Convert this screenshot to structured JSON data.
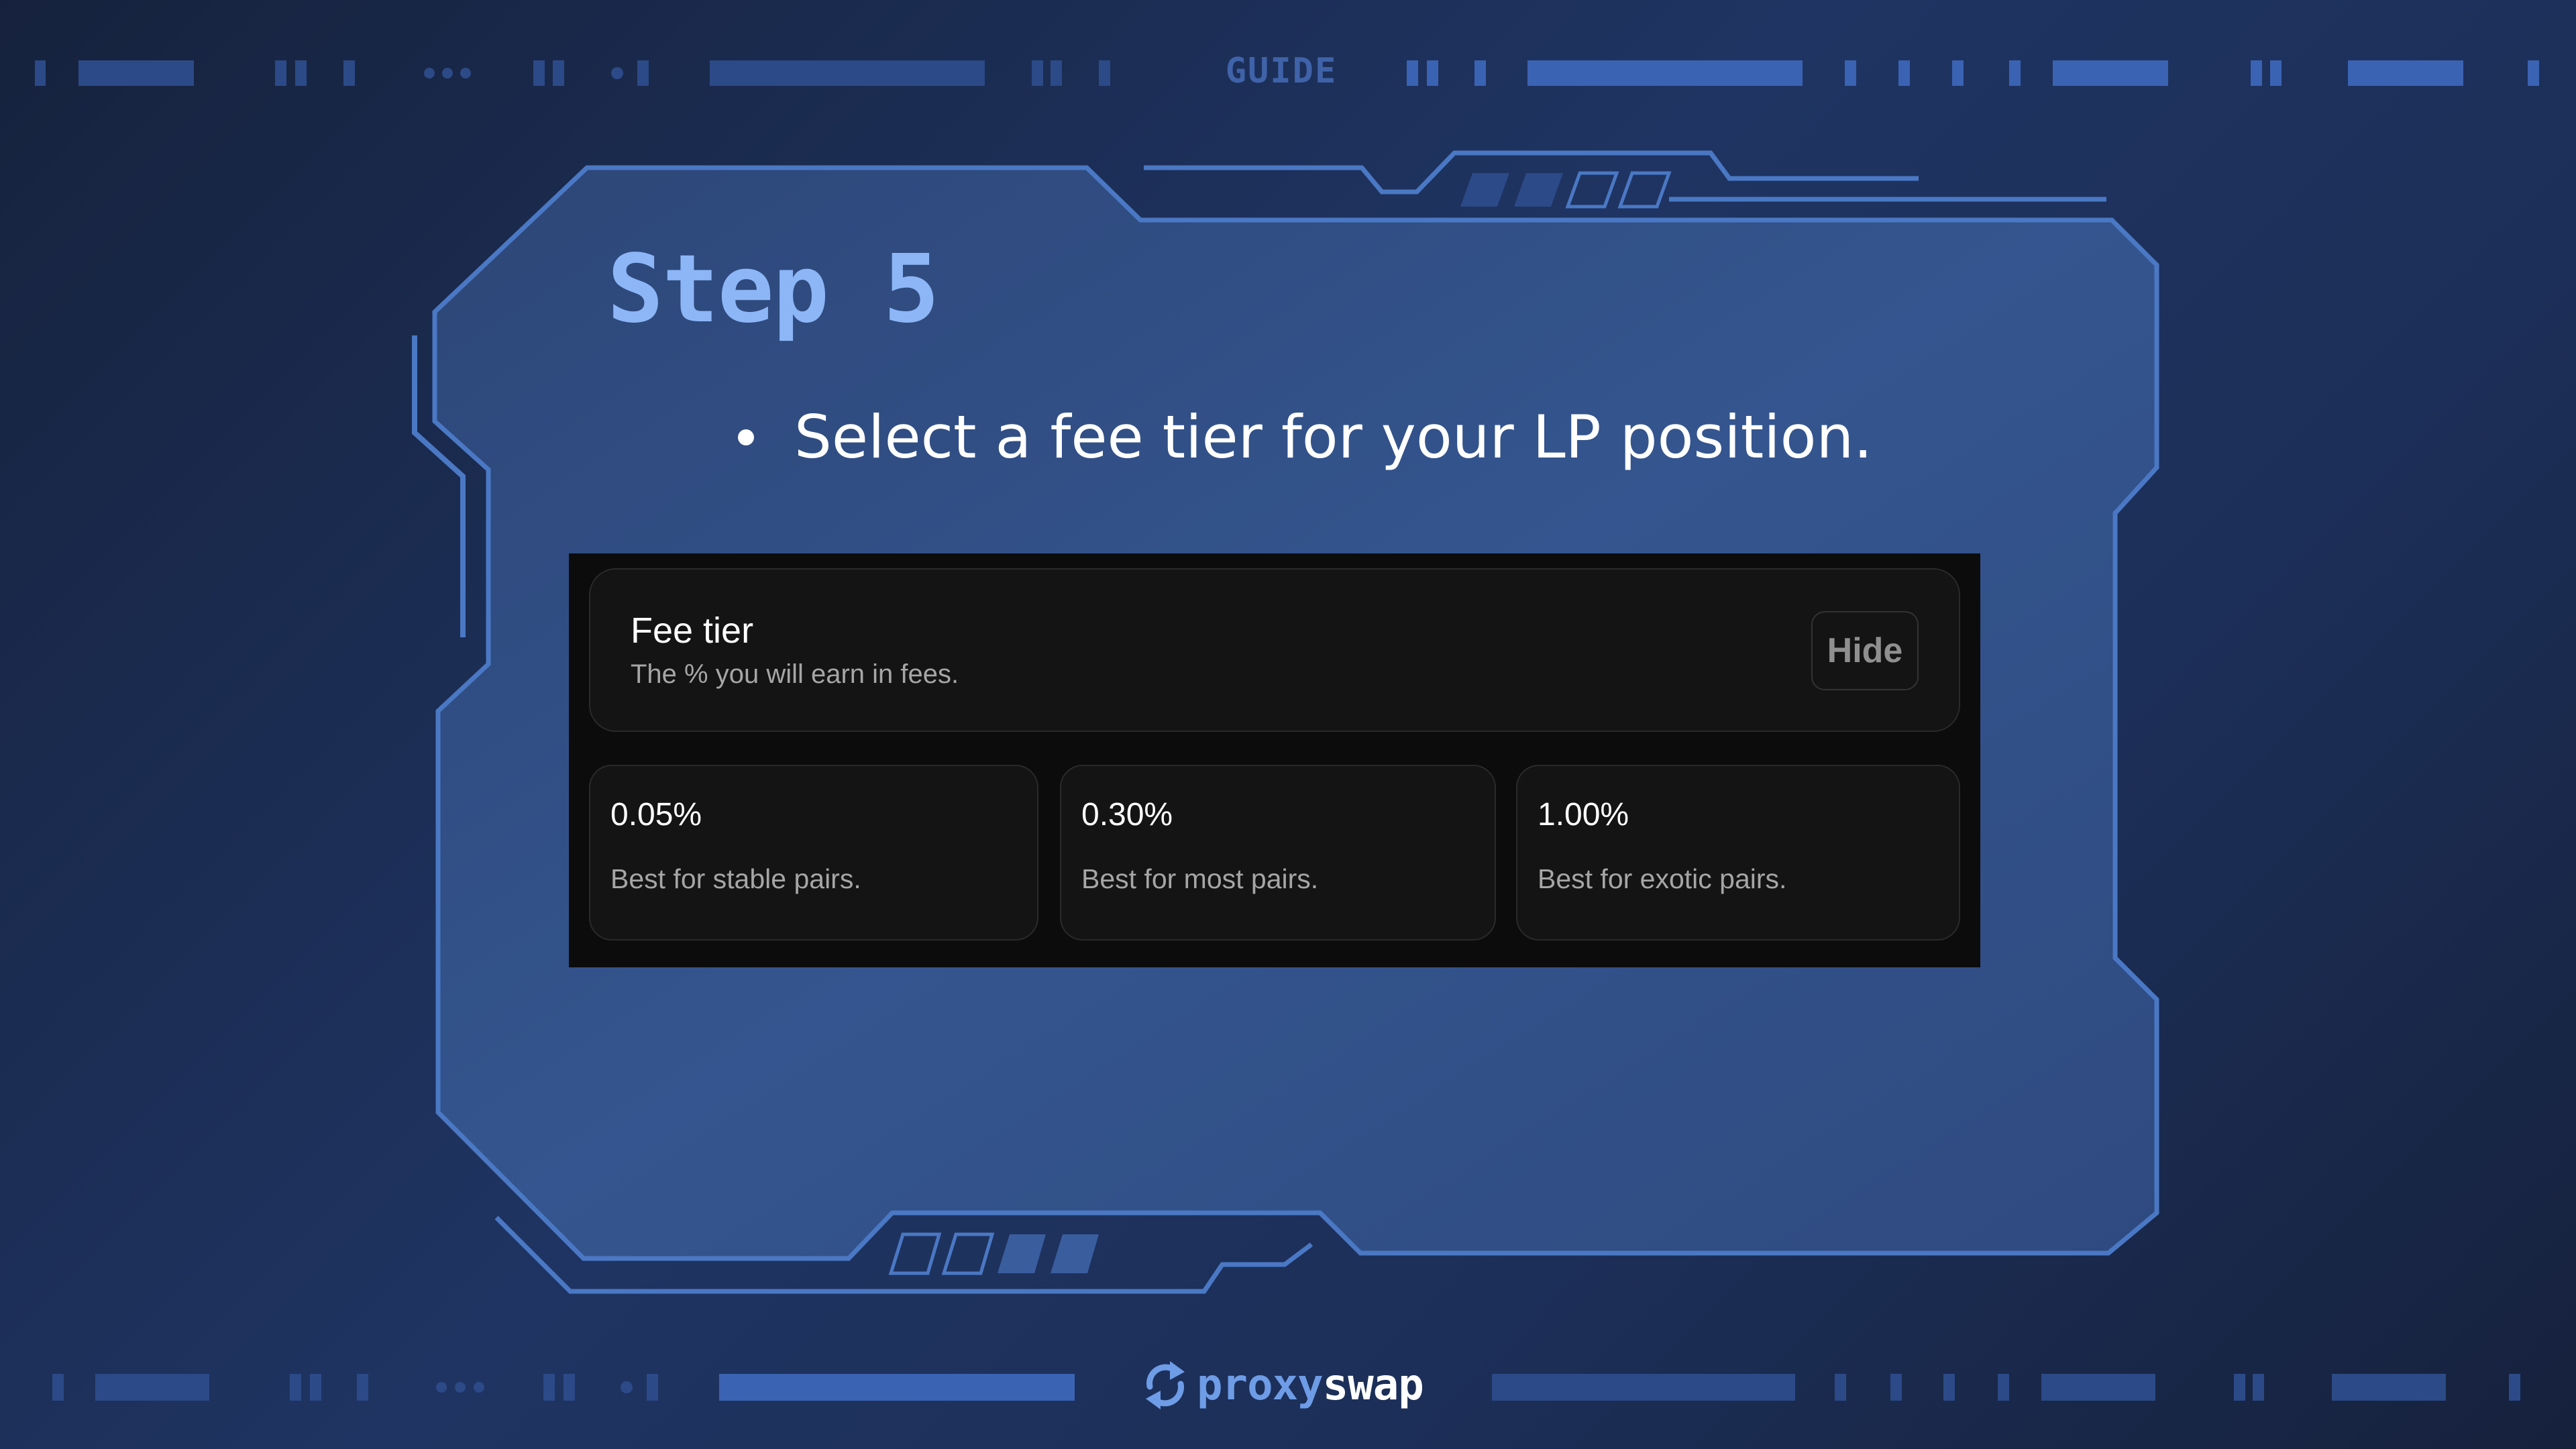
{
  "header": {
    "guide_label": "GUIDE"
  },
  "slide": {
    "title": "Step 5",
    "bullet": "Select a fee tier for your LP position."
  },
  "fee_panel": {
    "title": "Fee tier",
    "subtitle": "The % you will earn in fees.",
    "hide_label": "Hide",
    "tiers": [
      {
        "value": "0.05%",
        "description": "Best for stable pairs."
      },
      {
        "value": "0.30%",
        "description": "Best for most pairs."
      },
      {
        "value": "1.00%",
        "description": "Best for exotic pairs."
      }
    ]
  },
  "brand": {
    "name_part1": "proxy",
    "name_part2": "swap"
  },
  "colors": {
    "background": "#1c2f58",
    "frame_fill": "#33528e",
    "frame_stroke": "#4a78c4",
    "accent_title": "#8db6f7",
    "decor_dark": "#2c4a87",
    "decor_bright": "#3b63b3",
    "panel_bg": "#0c0c0c"
  }
}
